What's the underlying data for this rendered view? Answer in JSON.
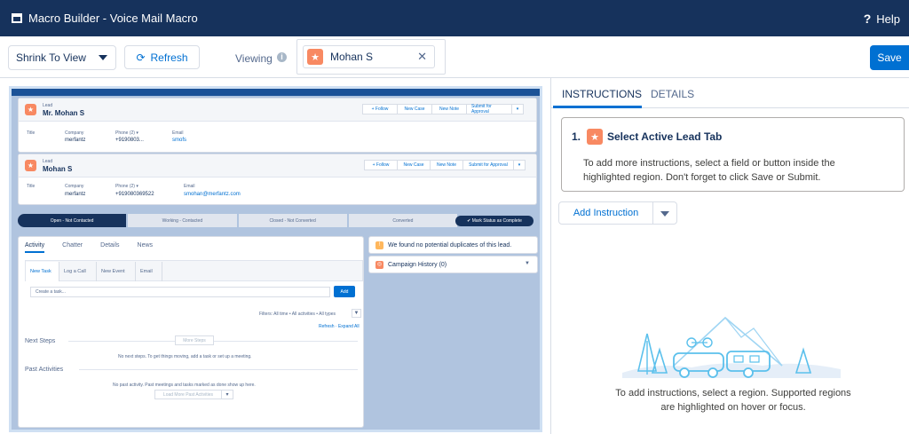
{
  "topbar": {
    "title": "Macro Builder - Voice Mail Macro",
    "help": "Help"
  },
  "toolbar": {
    "shrink_label": "Shrink To View",
    "refresh_label": "Refresh",
    "viewing_label": "Viewing",
    "viewing_user": "Mohan S",
    "save_label": "Save"
  },
  "preview": {
    "lead1": {
      "label": "Lead",
      "name": "Mr. Mohan S",
      "buttons": [
        "+ Follow",
        "New Case",
        "New Note",
        "Submit for Approval"
      ],
      "fields": {
        "title_label": "Title",
        "company_label": "Company",
        "company": "merfantz",
        "phone_label": "Phone (2) ▾",
        "phone": "+9190803...",
        "email_label": "Email",
        "email": "smofs"
      }
    },
    "lead2": {
      "label": "Lead",
      "name": "Mohan S",
      "buttons": [
        "+ Follow",
        "New Case",
        "New Note",
        "Submit for Approval"
      ],
      "fields": {
        "title_label": "Title",
        "company_label": "Company",
        "company": "merfantz",
        "phone_label": "Phone (2) ▾",
        "phone": "+919080369522",
        "email_label": "Email",
        "email": "smohan@merfantz.com"
      }
    },
    "path": {
      "steps": [
        "Open - Not Contacted",
        "Working - Contacted",
        "Closed - Not Converted",
        "Converted"
      ],
      "complete_label": "✔ Mark Status as Complete"
    },
    "activity": {
      "tabs": [
        "Activity",
        "Chatter",
        "Details",
        "News"
      ],
      "subtabs": [
        "New Task",
        "Log a Call",
        "New Event",
        "Email"
      ],
      "task_placeholder": "Create a task...",
      "add_label": "Add",
      "filters": "Filters: All time • All activities • All types",
      "refresh_expand": "Refresh · Expand All",
      "next_steps": "Next Steps",
      "more_steps": "More Steps",
      "no_next_steps": "No next steps. To get things moving, add a task or set up a meeting.",
      "past_activities": "Past Activities",
      "no_past": "No past activity. Past meetings and tasks marked as done show up here.",
      "load_more": "Load More Past Activities"
    },
    "duplicates": "We found no potential duplicates of this lead.",
    "campaign": "Campaign History (0)"
  },
  "right_panel": {
    "tabs": [
      "INSTRUCTIONS",
      "DETAILS"
    ],
    "step_number": "1.",
    "step_title": "Select Active Lead Tab",
    "step_text": "To add more instructions, select a field or button inside the highlighted region. Don't forget to click Save or Submit.",
    "add_instruction": "Add Instruction",
    "empty_text": "To add instructions, select a region. Supported regions are highlighted on hover or focus."
  },
  "colors": {
    "brand_navy": "#16325c",
    "action_blue": "#0070d2",
    "lead_orange": "#f88962"
  }
}
